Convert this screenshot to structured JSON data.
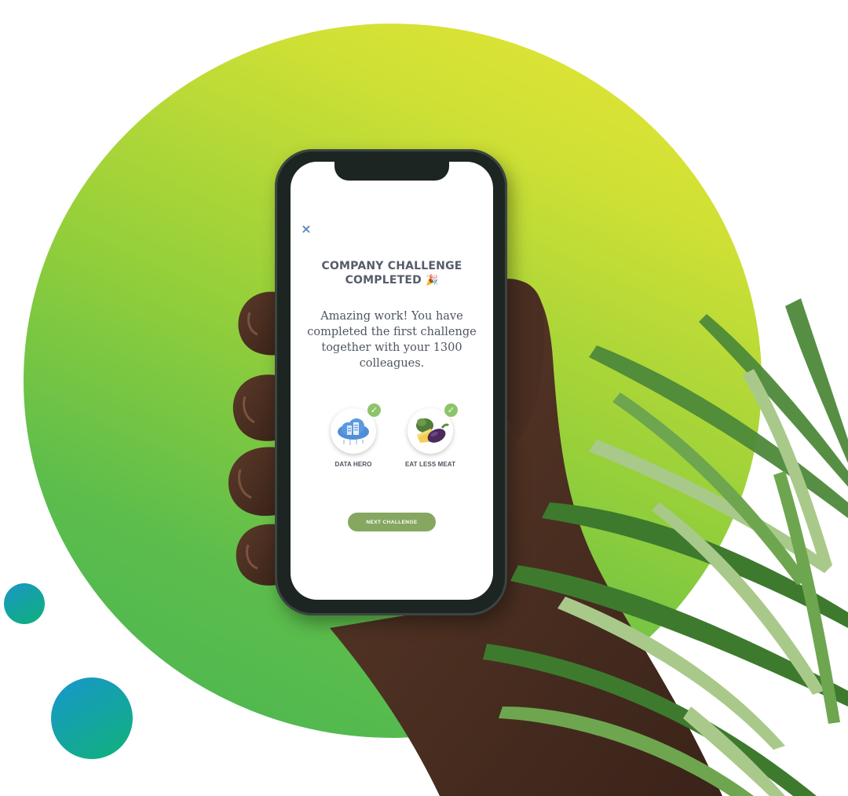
{
  "modal": {
    "title_line1": "COMPANY CHALLENGE",
    "title_line2": "COMPLETED",
    "title_icon": "🎉",
    "body": "Amazing work! You have completed the first challenge together with your 1300 colleagues.",
    "close_icon": "×"
  },
  "badges": [
    {
      "label": "DATA HERO",
      "icon": "cloud-data-icon",
      "status": "completed"
    },
    {
      "label": "EAT LESS MEAT",
      "icon": "vegetables-icon",
      "status": "completed"
    }
  ],
  "actions": {
    "next_label": "NEXT CHALLENGE"
  },
  "colors": {
    "circle_top": "#e7e735",
    "circle_bottom": "#48b553",
    "accent_dots": "#1a97c5",
    "button": "#86a760",
    "check": "#8dc46a",
    "close_icon": "#5a87b8"
  }
}
